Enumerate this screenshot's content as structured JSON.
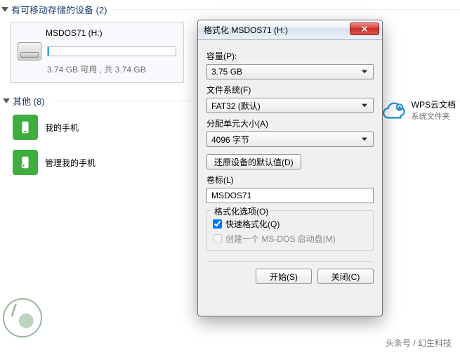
{
  "explorer": {
    "removable_header": "有可移动存储的设备 (2)",
    "drive": {
      "title": "MSDOS71 (H:)",
      "subtitle": "3.74 GB 可用 , 共 3.74 GB"
    },
    "other_header": "其他 (8)",
    "items": [
      {
        "label": "我的手机"
      },
      {
        "label": "管理我的手机"
      }
    ],
    "right_item": {
      "title": "WPS云文档",
      "subtitle": "系统文件夹"
    }
  },
  "dialog": {
    "title": "格式化 MSDOS71 (H:)",
    "capacity_label": "容量(P):",
    "capacity_value": "3.75 GB",
    "filesystem_label": "文件系统(F)",
    "filesystem_value": "FAT32 (默认)",
    "alloc_label": "分配单元大小(A)",
    "alloc_value": "4096 字节",
    "restore_defaults": "还原设备的默认值(D)",
    "volume_label": "卷标(L)",
    "volume_value": "MSDOS71",
    "options_label": "格式化选项(O)",
    "quick_format": "快速格式化(Q)",
    "create_dos": "创建一个 MS-DOS 启动盘(M)",
    "start": "开始(S)",
    "close": "关闭(C)"
  },
  "footer": {
    "credit": "头条号 / 幻生科技"
  }
}
